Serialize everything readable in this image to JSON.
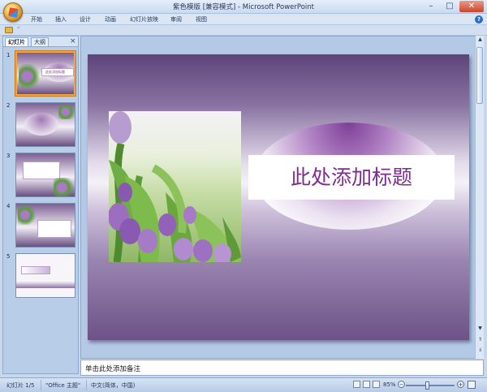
{
  "window": {
    "title": "紫色模版 [兼容模式] - Microsoft PowerPoint",
    "minimize": "–",
    "maximize": "□",
    "close": "✕"
  },
  "ribbon": {
    "tabs": [
      "开始",
      "插入",
      "设计",
      "动画",
      "幻灯片放映",
      "审阅",
      "视图"
    ],
    "help": "?"
  },
  "quick_access": {
    "customize": "⁼"
  },
  "left_pane": {
    "tabs": {
      "slides": "幻灯片",
      "outline": "大纲"
    },
    "close": "×",
    "slides": [
      {
        "number": "1",
        "label": "此处添加标题",
        "selected": true
      },
      {
        "number": "2",
        "label": ""
      },
      {
        "number": "3",
        "label": ""
      },
      {
        "number": "4",
        "label": ""
      },
      {
        "number": "5",
        "label": ""
      }
    ]
  },
  "slide": {
    "title": "此处添加标题"
  },
  "notes": {
    "placeholder": "单击此处添加备注"
  },
  "status": {
    "slide_count": "幻灯片 1/5",
    "theme": "\"Office 主题\"",
    "language": "中文(简体，中国)",
    "zoom": "85%",
    "zoom_level": 0.45
  },
  "colors": {
    "title_purple": "#7d2c8f",
    "ribbon_blue": "#dbe6f5",
    "selection_orange": "#f0a43a"
  }
}
